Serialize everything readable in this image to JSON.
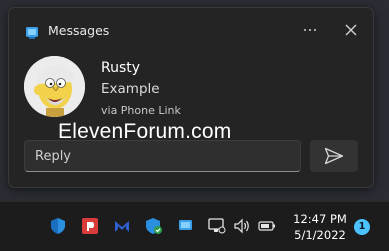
{
  "toast": {
    "app_name": "Messages",
    "sender": "Rusty",
    "message": "Example",
    "via": "via Phone Link",
    "reply_placeholder": "Reply",
    "more_icon": "more-horizontal-icon",
    "close_icon": "close-icon",
    "send_icon": "send-icon"
  },
  "watermark": "ElevenForum.com",
  "taskbar": {
    "time": "12:47 PM",
    "date": "5/1/2022",
    "notification_count": "1"
  },
  "colors": {
    "toast_bg": "#242424",
    "taskbar_bg": "#1c1c1c",
    "accent": "#4cc2ff"
  }
}
